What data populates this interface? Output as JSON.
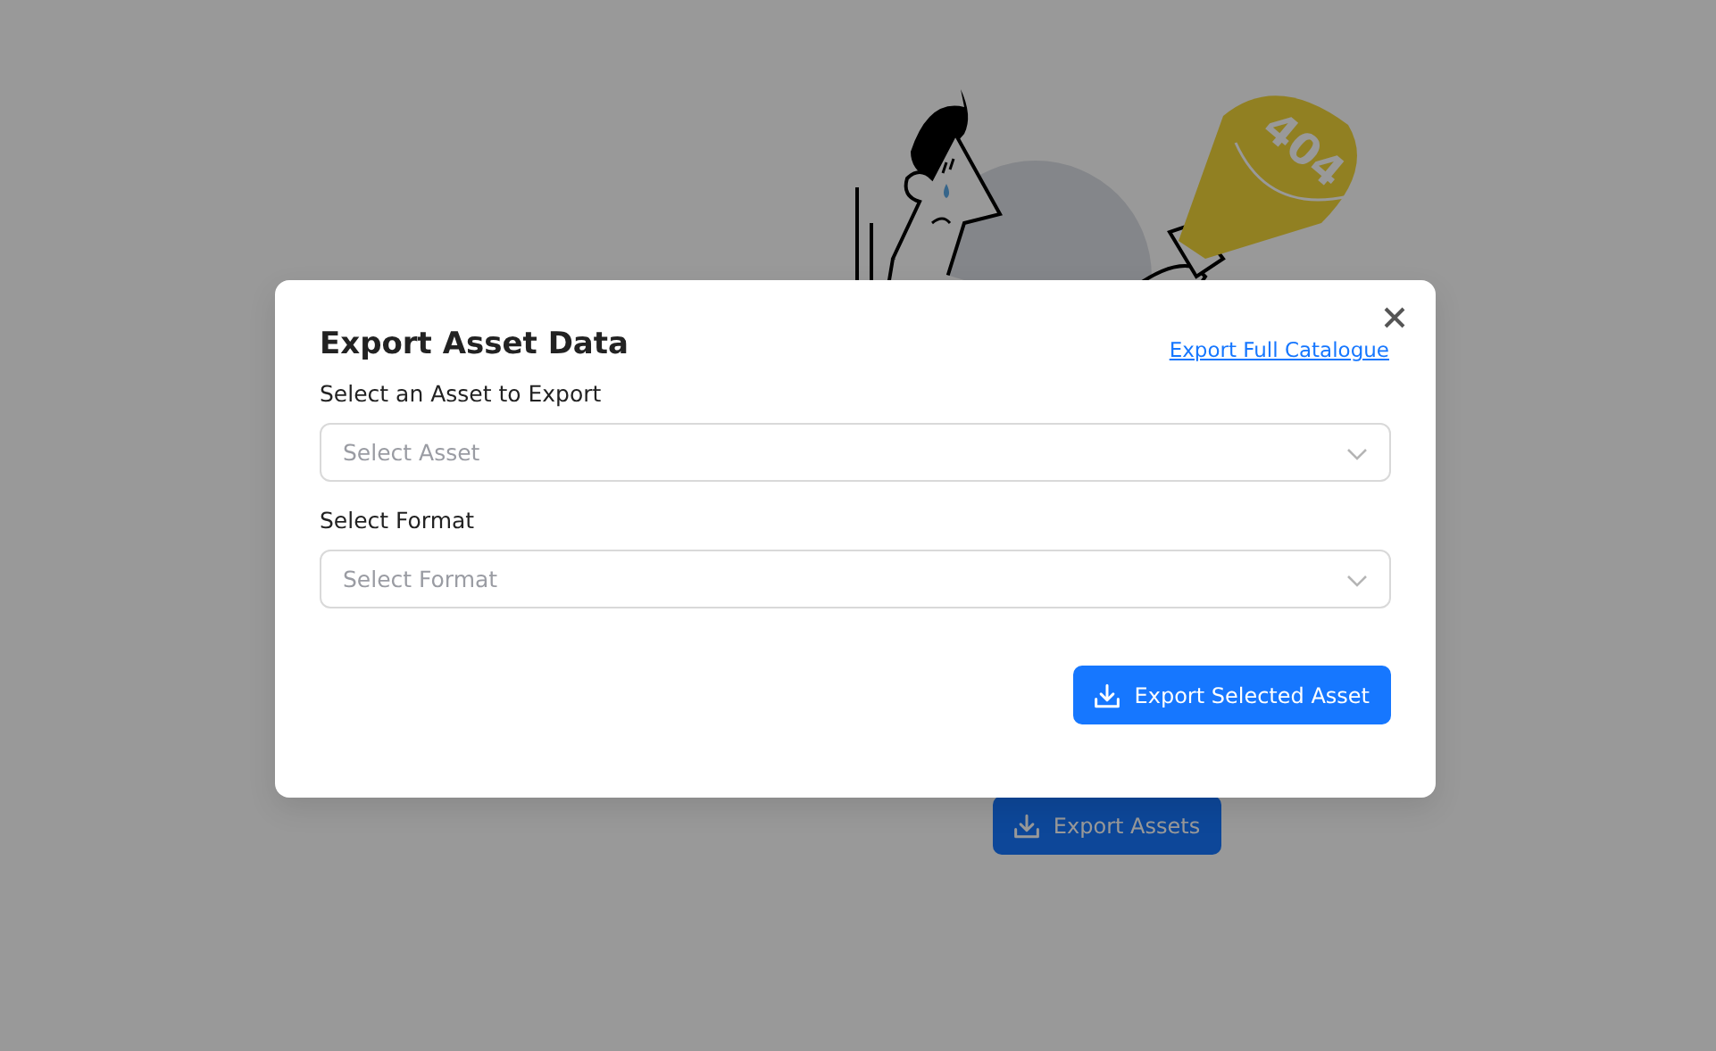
{
  "illustration": {
    "label": "404"
  },
  "page_button": {
    "label": "Export Assets"
  },
  "dialog": {
    "title": "Export Asset Data",
    "link": "Export Full Catalogue",
    "fields": [
      {
        "label": "Select an Asset to Export",
        "placeholder": "Select Asset"
      },
      {
        "label": "Select Format",
        "placeholder": "Select Format"
      }
    ],
    "submit": {
      "label": "Export Selected Asset"
    }
  }
}
